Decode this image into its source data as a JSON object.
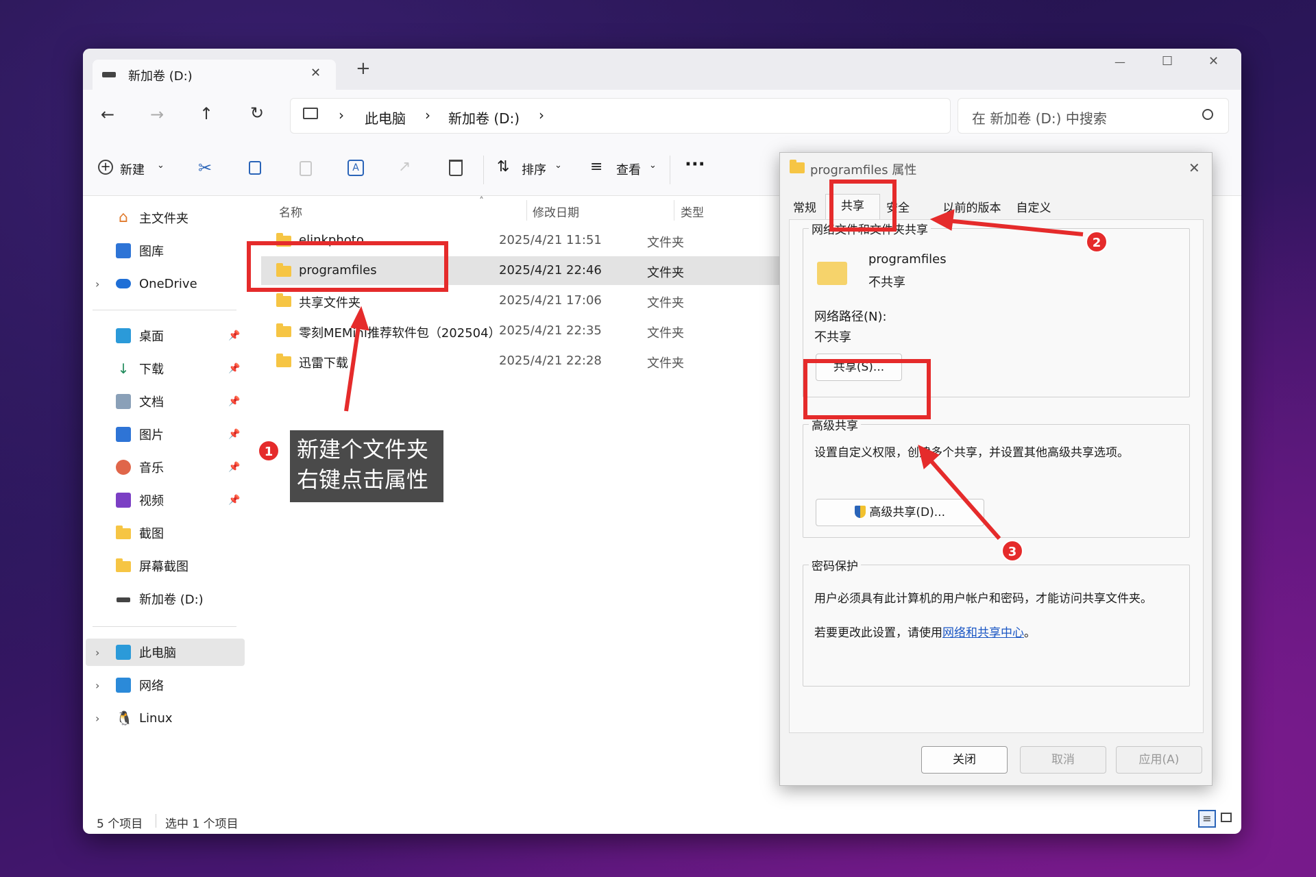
{
  "tab": {
    "title": "新加卷 (D:)",
    "close": "✕",
    "new_tab": "+"
  },
  "window_controls": {
    "minimize": "—",
    "maximize": "☐",
    "close": "✕"
  },
  "nav": {
    "back": "←",
    "forward": "→",
    "up": "↑",
    "refresh": "↻",
    "breadcrumb": [
      "此电脑",
      "新加卷 (D:)"
    ],
    "search_placeholder": "在 新加卷 (D:) 中搜索"
  },
  "toolbar": {
    "new_label": "新建",
    "sort_label": "排序",
    "view_label": "查看",
    "more": "···"
  },
  "sidebar": {
    "top": [
      {
        "label": "主文件夹",
        "icon": "home-icon"
      },
      {
        "label": "图库",
        "icon": "gallery-icon"
      },
      {
        "label": "OneDrive",
        "icon": "cloud-icon"
      }
    ],
    "quick": [
      {
        "label": "桌面",
        "icon": "desktop-icon"
      },
      {
        "label": "下载",
        "icon": "download-icon"
      },
      {
        "label": "文档",
        "icon": "document-icon"
      },
      {
        "label": "图片",
        "icon": "picture-icon"
      },
      {
        "label": "音乐",
        "icon": "music-icon"
      },
      {
        "label": "视频",
        "icon": "video-icon"
      },
      {
        "label": "截图",
        "icon": "folder-icon"
      },
      {
        "label": "屏幕截图",
        "icon": "folder-icon"
      },
      {
        "label": "新加卷 (D:)",
        "icon": "drive-icon"
      }
    ],
    "bottom": [
      {
        "label": "此电脑",
        "icon": "computer-icon"
      },
      {
        "label": "网络",
        "icon": "network-icon"
      },
      {
        "label": "Linux",
        "icon": "linux-icon"
      }
    ]
  },
  "columns": {
    "name": "名称",
    "date": "修改日期",
    "type": "类型"
  },
  "files": [
    {
      "name": "elinkphoto",
      "date": "2025/4/21 11:51",
      "type": "文件夹"
    },
    {
      "name": "programfiles",
      "date": "2025/4/21 22:46",
      "type": "文件夹"
    },
    {
      "name": "共享文件夹",
      "date": "2025/4/21 17:06",
      "type": "文件夹"
    },
    {
      "name": "零刻MEMini推荐软件包（202504）",
      "date": "2025/4/21 22:35",
      "type": "文件夹"
    },
    {
      "name": "迅雷下载",
      "date": "2025/4/21 22:28",
      "type": "文件夹"
    }
  ],
  "status": {
    "count": "5 个项目",
    "selected": "选中 1 个项目"
  },
  "dialog": {
    "title": "programfiles 属性",
    "tabs": [
      "常规",
      "共享",
      "安全",
      "以前的版本",
      "自定义"
    ],
    "net_share_group": "网络文件和文件夹共享",
    "folder_name": "programfiles",
    "share_state": "不共享",
    "net_path_label": "网络路径(N):",
    "net_path_value": "不共享",
    "share_button": "共享(S)...",
    "adv_group": "高级共享",
    "adv_desc": "设置自定义权限，创建多个共享，并设置其他高级共享选项。",
    "adv_button": "高级共享(D)...",
    "pwd_group": "密码保护",
    "pwd_desc": "用户必须具有此计算机的用户帐户和密码，才能访问共享文件夹。",
    "pwd_change_prefix": "若要更改此设置，请使用",
    "pwd_link": "网络和共享中心",
    "pwd_change_suffix": "。",
    "close_btn": "关闭",
    "cancel_btn": "取消",
    "apply_btn": "应用(A)"
  },
  "annotations": {
    "callout_line1": "新建个文件夹",
    "callout_line2": "右键点击属性",
    "badge1": "1",
    "badge2": "2",
    "badge3": "3"
  }
}
